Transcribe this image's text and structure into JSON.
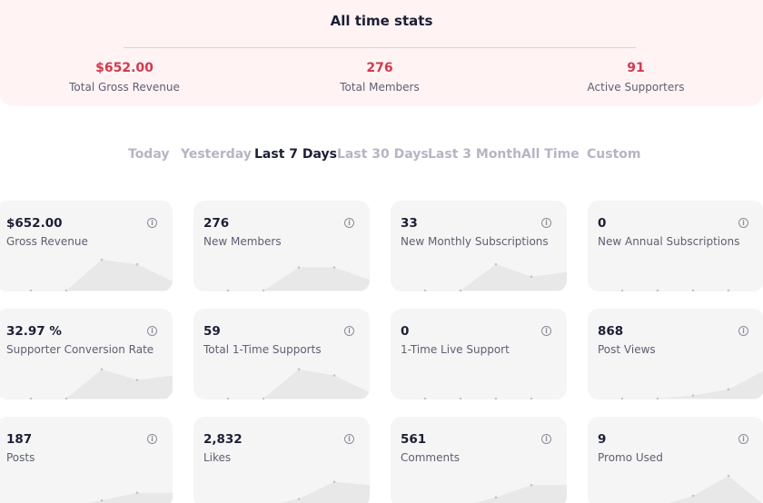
{
  "all_time": {
    "title": "All time stats",
    "stats": [
      {
        "value": "$652.00",
        "label": "Total Gross Revenue"
      },
      {
        "value": "276",
        "label": "Total Members"
      },
      {
        "value": "91",
        "label": "Active Supporters"
      }
    ]
  },
  "filters": {
    "tabs": [
      "Today",
      "Yesterday",
      "Last 7 Days",
      "Last 30 Days",
      "Last 3 Month",
      "All Time",
      "Custom"
    ],
    "active": "Last 7 Days"
  },
  "cards": [
    {
      "value": "$652.00",
      "label": "Gross Revenue",
      "trend": [
        0,
        0,
        0,
        1,
        0.85,
        0.3,
        0.1
      ]
    },
    {
      "value": "276",
      "label": "New Members",
      "trend": [
        0,
        0,
        0,
        0.75,
        0.75,
        0.35,
        0.2
      ]
    },
    {
      "value": "33",
      "label": "New Monthly Subscriptions",
      "trend": [
        0,
        0,
        0,
        0.85,
        0.45,
        0.6,
        0.7
      ]
    },
    {
      "value": "0",
      "label": "New Annual Subscriptions",
      "trend": [
        0,
        0,
        0,
        0,
        0,
        0,
        0
      ]
    },
    {
      "value": "32.97 %",
      "label": "Supporter Conversion Rate",
      "trend": [
        0,
        0,
        0,
        0.95,
        0.6,
        0.75,
        0.85
      ]
    },
    {
      "value": "59",
      "label": "Total 1-Time Supports",
      "trend": [
        0,
        0,
        0,
        0.95,
        0.75,
        0.2,
        0.1
      ]
    },
    {
      "value": "0",
      "label": "1-Time Live Support",
      "trend": [
        0,
        0,
        0,
        0,
        0,
        0,
        0
      ]
    },
    {
      "value": "868",
      "label": "Post Views",
      "trend": [
        0,
        0,
        0,
        0.1,
        0.3,
        0.9,
        0.9
      ]
    },
    {
      "value": "187",
      "label": "Posts",
      "trend": [
        0,
        0,
        0,
        0.2,
        0.45,
        0.45,
        0.45
      ]
    },
    {
      "value": "2,832",
      "label": "Likes",
      "trend": [
        0,
        0,
        0,
        0.25,
        0.8,
        0.7,
        0.7
      ]
    },
    {
      "value": "561",
      "label": "Comments",
      "trend": [
        0,
        0,
        0,
        0.3,
        0.7,
        0.7,
        0.7
      ]
    },
    {
      "value": "9",
      "label": "Promo Used",
      "trend": [
        0,
        0,
        0,
        0.35,
        1,
        0.05,
        0
      ]
    }
  ],
  "colors": {
    "accent": "#d23a4b",
    "stats_background": "#fff3f4",
    "card_background": "#f5f5f5",
    "sparkline_fill": "#e8e8e8",
    "sparkline_dot": "#c4c4c4"
  },
  "icons": {
    "info": "info-icon"
  }
}
